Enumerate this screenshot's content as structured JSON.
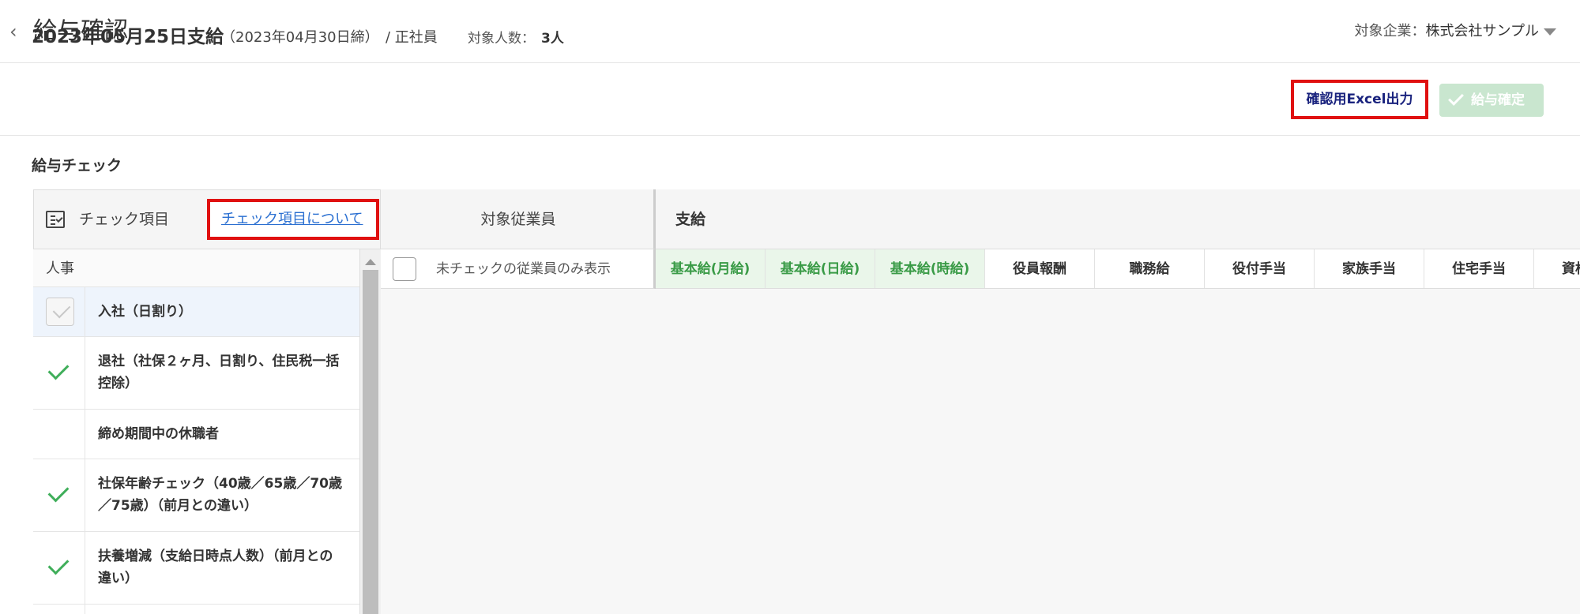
{
  "header": {
    "back_icon": "chevron-left-icon",
    "title": "給与確認",
    "company_label": "対象企業：",
    "company_name": "株式会社サンプル"
  },
  "payroll": {
    "pay_date": "2023年05月25日支給",
    "cutoff": "（2023年04月30日締）",
    "employment_type": "/ 正社員",
    "headcount_label": "対象人数：",
    "headcount_value": "3人",
    "excel_button": "確認用Excel出力",
    "confirm_button": "給与確定"
  },
  "check": {
    "section_title": "給与チェック",
    "items_header": "チェック項目",
    "about_link": "チェック項目について",
    "target_employees_header": "対象従業員",
    "only_unchecked_label": "未チェックの従業員のみ表示",
    "payment_header": "支給",
    "group_label": "人事",
    "items": [
      {
        "label": "入社（日割り）",
        "state": "disabled"
      },
      {
        "label": "退社（社保２ヶ月、日割り、住民税一括控除）",
        "state": "checked"
      },
      {
        "label": "締め期間中の休職者",
        "state": "none"
      },
      {
        "label": "社保年齢チェック（40歳／65歳／70歳／75歳）（前月との違い）",
        "state": "checked"
      },
      {
        "label": "扶養増減（支給日時点人数）（前月との違い）",
        "state": "checked"
      }
    ],
    "payment_columns": [
      {
        "label": "基本給(月給)",
        "highlight": true
      },
      {
        "label": "基本給(日給)",
        "highlight": true
      },
      {
        "label": "基本給(時給)",
        "highlight": true
      },
      {
        "label": "役員報酬",
        "highlight": false
      },
      {
        "label": "職務給",
        "highlight": false
      },
      {
        "label": "役付手当",
        "highlight": false
      },
      {
        "label": "家族手当",
        "highlight": false
      },
      {
        "label": "住宅手当",
        "highlight": false
      },
      {
        "label": "資格手当",
        "highlight": false
      }
    ]
  },
  "colors": {
    "accent_red": "#e01010",
    "check_green": "#3fae5a",
    "highlight_green_bg": "#eaf6ea",
    "link_blue": "#2a6fd1"
  }
}
